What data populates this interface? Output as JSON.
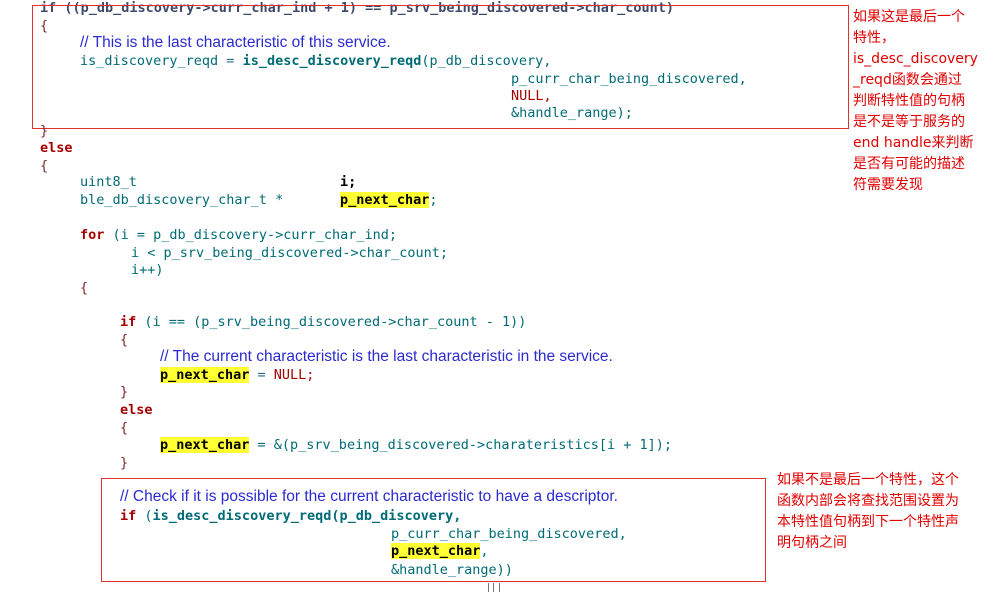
{
  "code": {
    "l01": "if ((p_db_discovery->curr_char_ind + 1) == p_srv_being_discovered->char_count)",
    "l02": "{",
    "l03": "// This is the last characteristic of this service.",
    "l04a": "is_discovery_reqd",
    "l04b": " = ",
    "l04c": "is_desc_discovery_reqd",
    "l04d": "(p_db_discovery,",
    "l05": "p_curr_char_being_discovered,",
    "l06": "NULL,",
    "l07": "&handle_range);",
    "l08": "}",
    "l09": "else",
    "l10": "{",
    "l11a": "uint8_t",
    "l11b": "i;",
    "l12a": "ble_db_discovery_char_t *",
    "l12b": "p_next_char",
    "l12c": ";",
    "l14a": "for",
    "l14b": " (i = p_db_discovery->curr_char_ind;",
    "l15": "i < p_srv_being_discovered->char_count;",
    "l16": "i++)",
    "l17": "{",
    "l19a": "if",
    "l19b": " (i == (p_srv_being_discovered->char_count - 1))",
    "l20": "{",
    "l21": "// The current characteristic is the last characteristic in the service.",
    "l22a": "p_next_char",
    "l22b": " = ",
    "l22c": "NULL;",
    "l23": "}",
    "l24": "else",
    "l25": "{",
    "l26a": "p_next_char",
    "l26b": " = &(p_srv_being_discovered->charateristics[i + 1]);",
    "l27": "}",
    "l29": "// Check if it is possible for the current characteristic to have a descriptor.",
    "l30a": "if",
    "l30b": " (",
    "l30c": "is_desc_discovery_reqd",
    "l30d": "(p_db_discovery,",
    "l31": "p_curr_char_being_discovered,",
    "l32a": "p_next_char",
    "l32b": ",",
    "l33": "&handle_range))"
  },
  "annotations": {
    "top": [
      "如果这是最后一个",
      "特性，",
      "is_desc_discovery",
      "_reqd函数会通过",
      "判断特性值的句柄",
      "是不是等于服务的",
      "end handle来判断",
      "是否有可能的描述",
      "符需要发现"
    ],
    "bottom": [
      "如果不是最后一个特性，这个",
      "函数内部会将查找范围设置为",
      "本特性值句柄到下一个特性声",
      "明句柄之间"
    ]
  },
  "colors": {
    "keyword": "#a50000",
    "identifier": "#006b75",
    "comment": "#2a2ad0",
    "highlight": "#ffff33",
    "annotation": "#e00000"
  }
}
